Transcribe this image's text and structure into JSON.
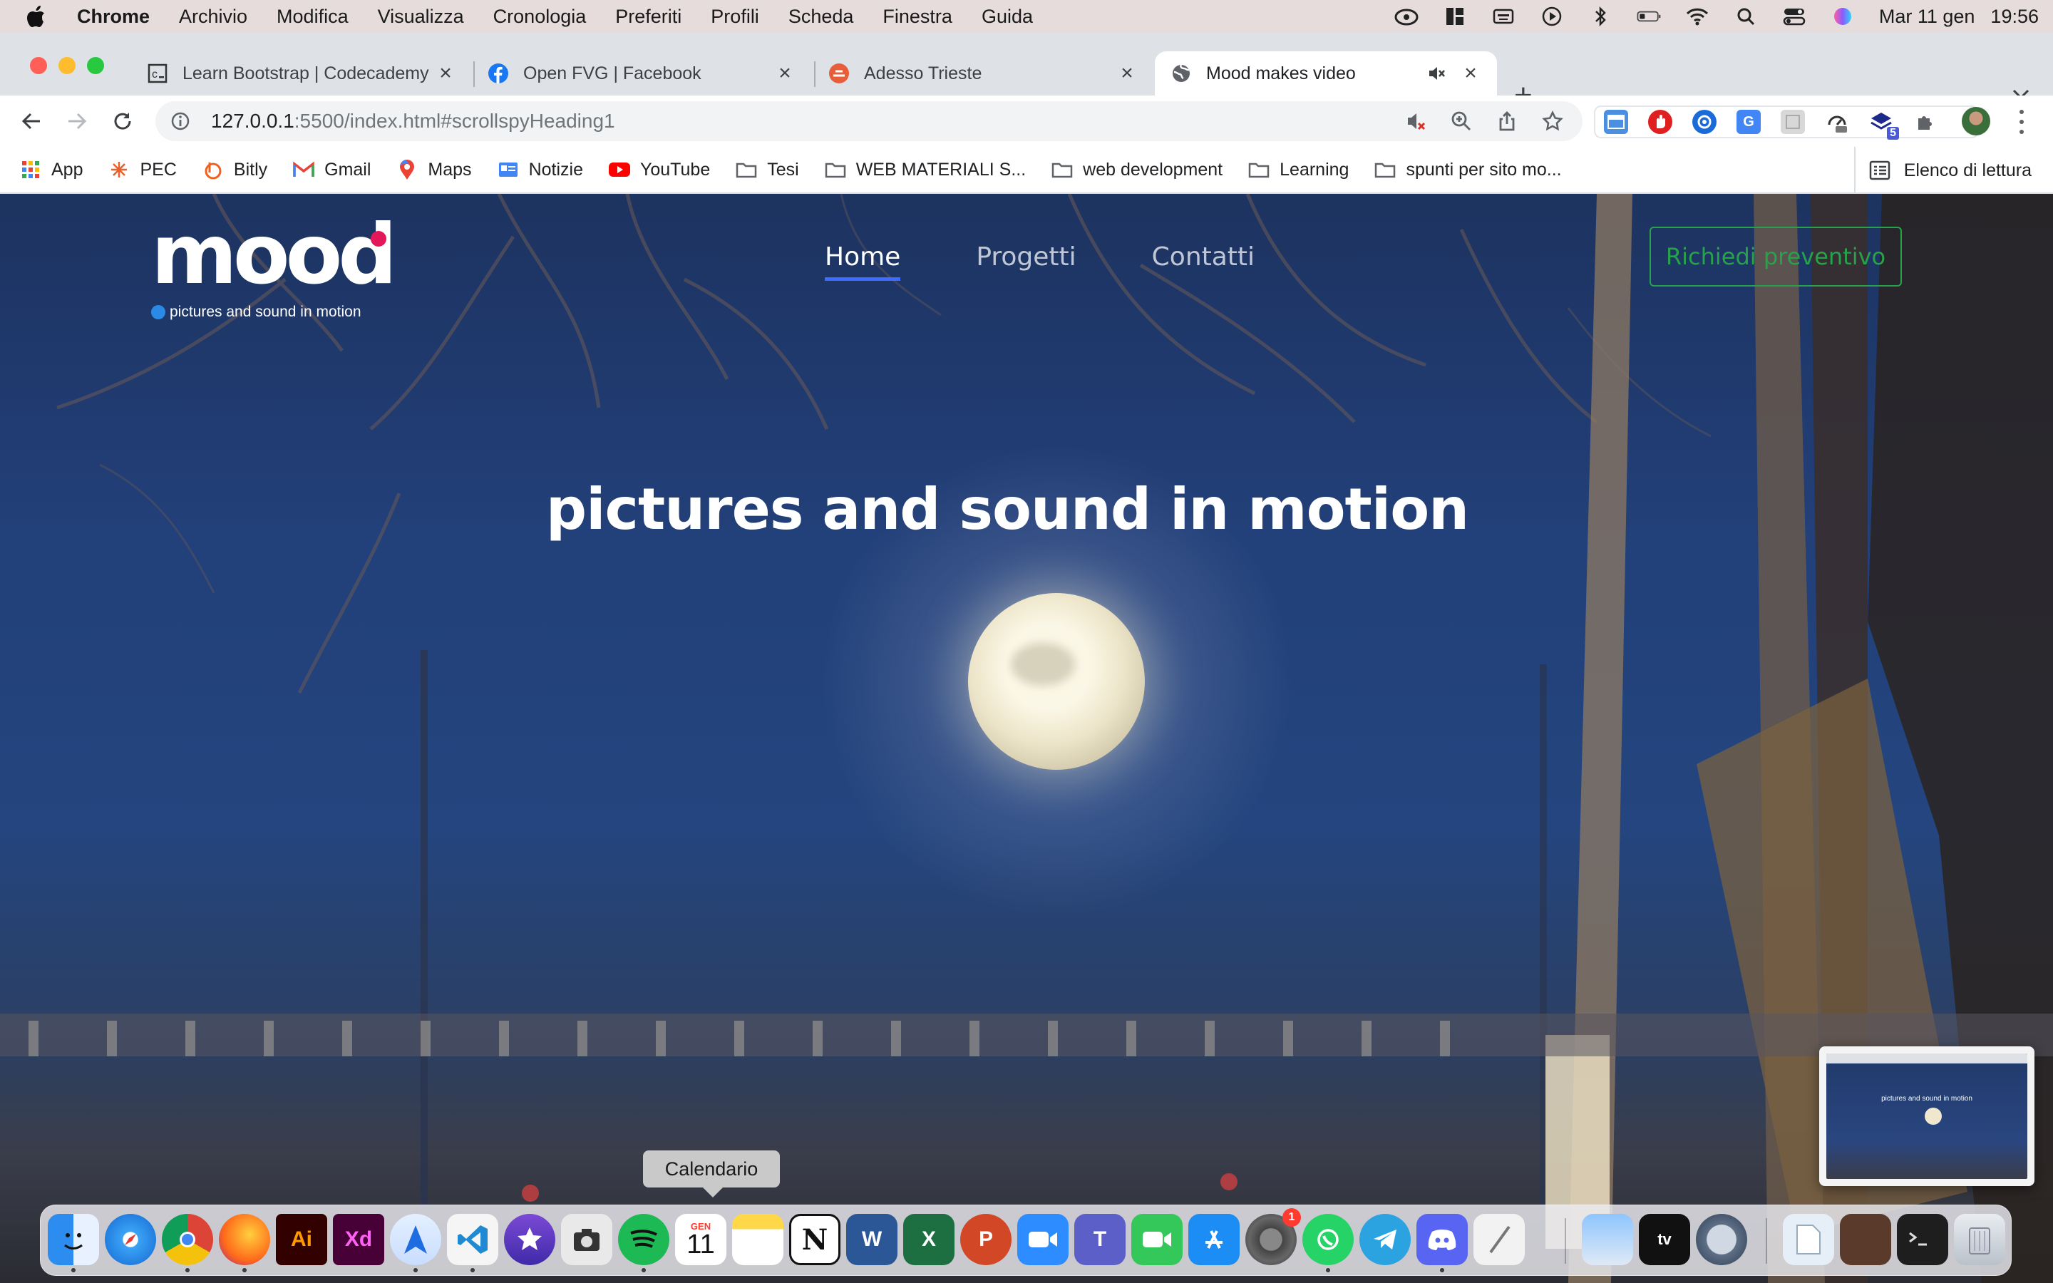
{
  "menubar": {
    "app_name": "Chrome",
    "items": [
      "Archivio",
      "Modifica",
      "Visualizza",
      "Cronologia",
      "Preferiti",
      "Profili",
      "Scheda",
      "Finestra",
      "Guida"
    ],
    "date": "Mar 11 gen",
    "time": "19:56"
  },
  "tabs": [
    {
      "title": "Learn Bootstrap | Codecademy",
      "icon": "codecademy-icon",
      "active": false
    },
    {
      "title": "Open FVG | Facebook",
      "icon": "facebook-icon",
      "active": false
    },
    {
      "title": "Adesso Trieste",
      "icon": "adesso-trieste-icon",
      "active": false
    },
    {
      "title": "Mood makes video",
      "icon": "globe-icon",
      "active": true,
      "muted": true
    }
  ],
  "omnibox": {
    "url_host": "127.0.0.1",
    "url_path": ":5500/index.html#scrollspyHeading1"
  },
  "extensions": {
    "badge_count": "5"
  },
  "bookmarks": [
    {
      "label": "App",
      "icon": "apps-grid-icon"
    },
    {
      "label": "PEC",
      "icon": "pec-icon"
    },
    {
      "label": "Bitly",
      "icon": "bitly-icon"
    },
    {
      "label": "Gmail",
      "icon": "gmail-icon"
    },
    {
      "label": "Maps",
      "icon": "maps-icon"
    },
    {
      "label": "Notizie",
      "icon": "google-news-icon"
    },
    {
      "label": "YouTube",
      "icon": "youtube-icon"
    },
    {
      "label": "Tesi",
      "icon": "folder-icon"
    },
    {
      "label": "WEB MATERIALI S...",
      "icon": "folder-icon"
    },
    {
      "label": "web development",
      "icon": "folder-icon"
    },
    {
      "label": "Learning",
      "icon": "folder-icon"
    },
    {
      "label": "spunti per sito mo...",
      "icon": "folder-icon"
    }
  ],
  "reading_list": "Elenco di lettura",
  "site": {
    "logo_wordmark": "mood",
    "logo_tagline": "pictures and sound in motion",
    "nav": [
      {
        "label": "Home",
        "active": true
      },
      {
        "label": "Progetti",
        "active": false
      },
      {
        "label": "Contatti",
        "active": false
      }
    ],
    "cta_label": "Richiedi preventivo",
    "hero_title": "pictures and sound in motion",
    "colors": {
      "nav_active_underline": "#3d6bff",
      "cta_green": "#27a24a",
      "logo_pink_dot": "#e2185b",
      "logo_blue_dot": "#2a8ae6"
    }
  },
  "thumbnail": {
    "title": "pictures and sound in motion"
  },
  "tooltip": "Calendario",
  "dock": {
    "calendar_month": "GEN",
    "calendar_day": "11",
    "settings_badge": "1",
    "items": [
      "finder",
      "safari",
      "chrome",
      "firefox",
      "illustrator",
      "adobe-xd",
      "testflight",
      "vscode",
      "imovie",
      "screenshot",
      "spotify",
      "calendar",
      "notes",
      "notion",
      "word",
      "excel",
      "powerpoint",
      "zoom",
      "teams",
      "facetime",
      "app-store",
      "system-preferences",
      "whatsapp",
      "telegram",
      "discord",
      "textedit",
      "preview",
      "apple-tv",
      "quicktime",
      "pdf-file",
      "photo-booth",
      "terminal",
      "trash"
    ]
  }
}
